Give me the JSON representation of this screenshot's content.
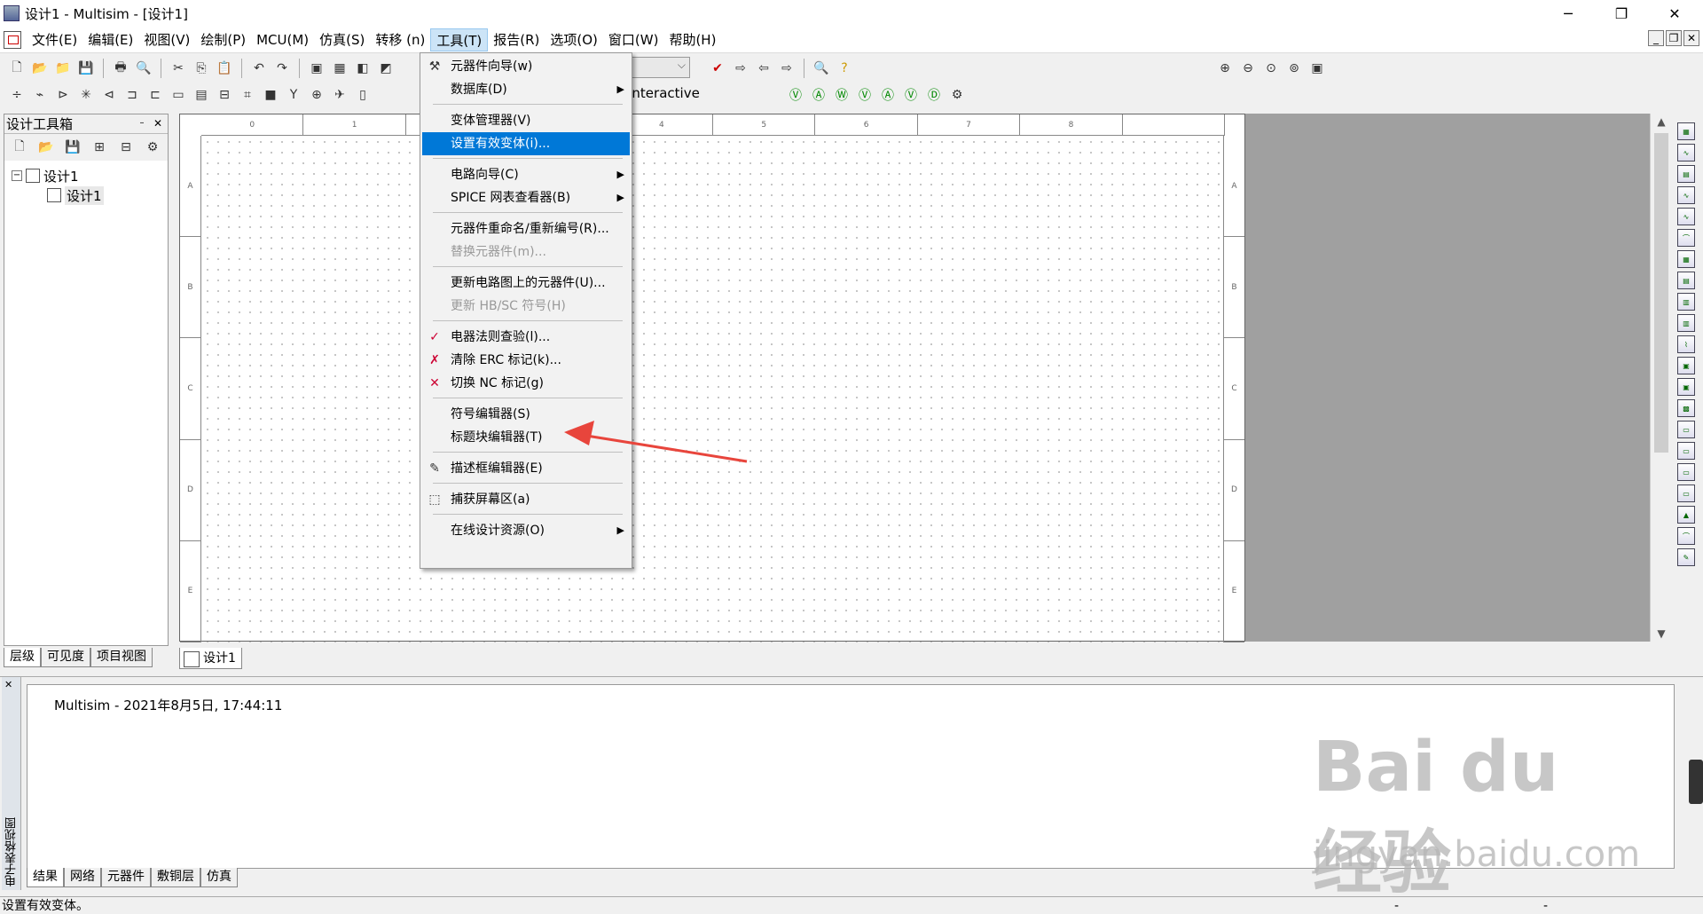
{
  "window": {
    "title": "设计1 - Multisim - [设计1]",
    "minimize": "─",
    "restore": "❐",
    "close": "✕"
  },
  "menubar": {
    "items": [
      "文件(E)",
      "编辑(E)",
      "视图(V)",
      "绘制(P)",
      "MCU(M)",
      "仿真(S)",
      "转移 (n)",
      "工具(T)",
      "报告(R)",
      "选项(O)",
      "窗口(W)",
      "帮助(H)"
    ],
    "active_index": 7,
    "mdi": {
      "minimize": "_",
      "restore": "❐",
      "close": "✕"
    }
  },
  "toolbar": {
    "interactive_label": "Interactive"
  },
  "design_toolbox": {
    "title": "设计工具箱",
    "tree": {
      "root": "设计1",
      "child": "设计1"
    },
    "tabs": [
      "层级",
      "可见度",
      "项目视图"
    ]
  },
  "sheet": {
    "columns": [
      "0",
      "1",
      "2",
      "3",
      "4",
      "5",
      "6",
      "7",
      "8",
      ""
    ],
    "rows": [
      "A",
      "B",
      "C",
      "D",
      "E"
    ],
    "tab_label": "设计1"
  },
  "tools_menu": {
    "items": [
      {
        "label": "元器件向导(w)",
        "icon": "component-wizard-icon"
      },
      {
        "label": "数据库(D)",
        "submenu": true
      },
      {
        "label": "变体管理器(V)"
      },
      {
        "label": "设置有效变体(i)...",
        "highlighted": true
      },
      {
        "label": "电路向导(C)",
        "submenu": true
      },
      {
        "label": "SPICE 网表查看器(B)",
        "submenu": true
      },
      {
        "label": "元器件重命名/重新编号(R)..."
      },
      {
        "label": "替换元器件(m)...",
        "disabled": true
      },
      {
        "label": "更新电路图上的元器件(U)..."
      },
      {
        "label": "更新 HB/SC 符号(H)",
        "disabled": true
      },
      {
        "label": "电器法则查验(l)...",
        "icon": "erc-check-icon"
      },
      {
        "label": "清除 ERC 标记(k)...",
        "icon": "clear-erc-icon"
      },
      {
        "label": "切换 NC 标记(g)",
        "icon": "nc-marker-icon"
      },
      {
        "label": "符号编辑器(S)"
      },
      {
        "label": "标题块编辑器(T)"
      },
      {
        "label": "描述框编辑器(E)",
        "icon": "description-box-icon"
      },
      {
        "label": "捕获屏幕区(a)",
        "icon": "capture-screen-icon"
      },
      {
        "label": "在线设计资源(O)",
        "submenu": true
      }
    ],
    "submenu_glyph": "▶"
  },
  "output": {
    "line": "Multisim  -  2021年8月5日, 17:44:11",
    "side_label": "电子表格视图",
    "close": "✕",
    "tabs": [
      "结果",
      "网络",
      "元器件",
      "敷铜层",
      "仿真"
    ]
  },
  "status": {
    "text": "设置有效变体。",
    "dash": "-"
  },
  "watermark": {
    "main": "Bai du 经验",
    "url": "jingyan.baidu.com"
  },
  "colors": {
    "highlight": "#0078d7",
    "arrow": "#e8453c"
  }
}
